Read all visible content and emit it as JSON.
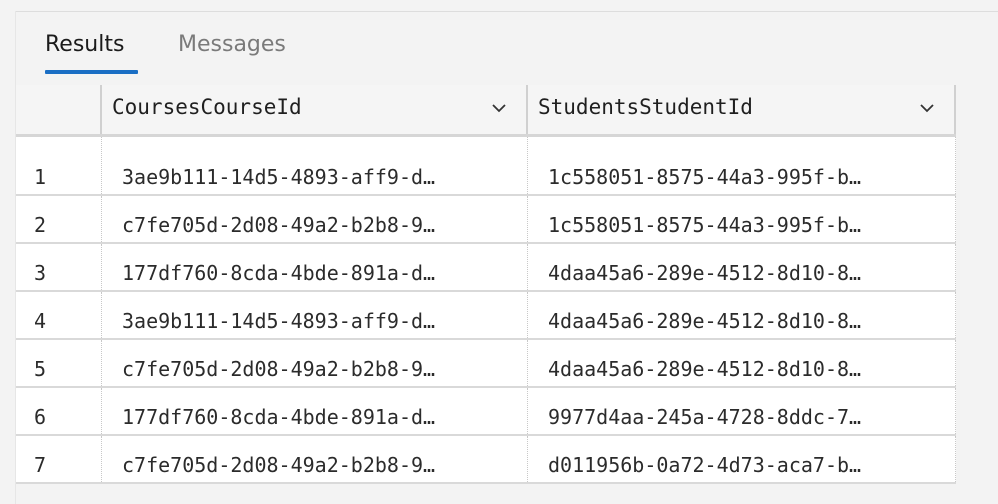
{
  "tabs": {
    "results": "Results",
    "messages": "Messages"
  },
  "grid": {
    "columns": [
      "CoursesCourseId",
      "StudentsStudentId"
    ],
    "rows": [
      [
        "1",
        "3ae9b111-14d5-4893-aff9-d…",
        "1c558051-8575-44a3-995f-b…"
      ],
      [
        "2",
        "c7fe705d-2d08-49a2-b2b8-9…",
        "1c558051-8575-44a3-995f-b…"
      ],
      [
        "3",
        "177df760-8cda-4bde-891a-d…",
        "4daa45a6-289e-4512-8d10-8…"
      ],
      [
        "4",
        "3ae9b111-14d5-4893-aff9-d…",
        "4daa45a6-289e-4512-8d10-8…"
      ],
      [
        "5",
        "c7fe705d-2d08-49a2-b2b8-9…",
        "4daa45a6-289e-4512-8d10-8…"
      ],
      [
        "6",
        "177df760-8cda-4bde-891a-d…",
        "9977d4aa-245a-4728-8ddc-7…"
      ],
      [
        "7",
        "c7fe705d-2d08-49a2-b2b8-9…",
        "d011956b-0a72-4d73-aca7-b…"
      ]
    ]
  },
  "icons": {
    "column_menu": "chevron-down-icon"
  },
  "colors": {
    "active_tab_underline": "#1a6ec4",
    "background": "#f3f3f3",
    "grid_background": "#ffffff"
  }
}
